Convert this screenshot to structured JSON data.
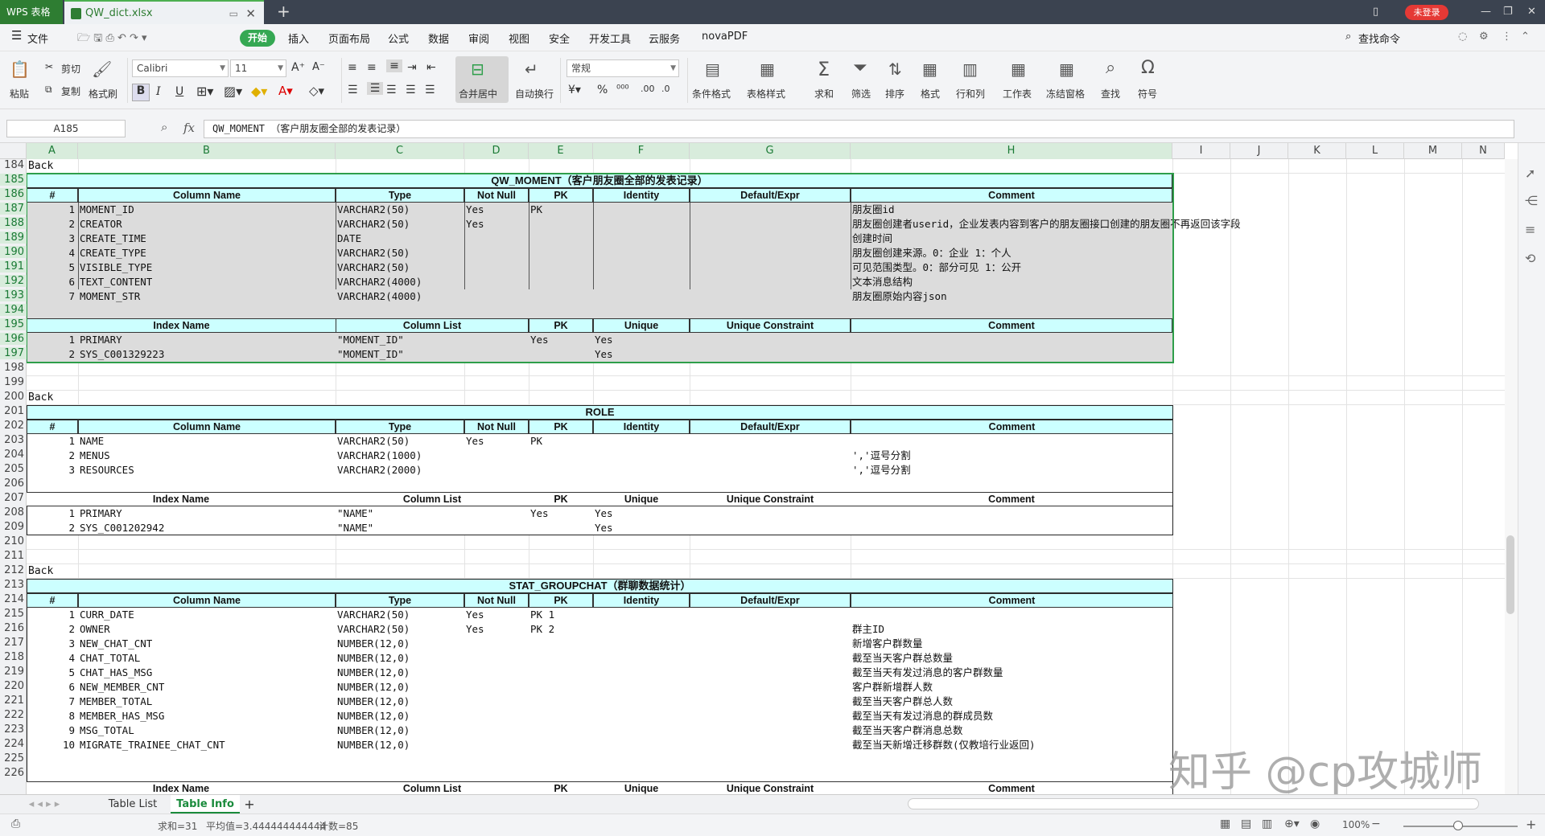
{
  "titlebar": {
    "app_tab": "WPS 表格",
    "file_tab": "QW_dict.xlsx",
    "login_badge": "未登录"
  },
  "menu": {
    "file": "文件",
    "start": "开始",
    "items": [
      "插入",
      "页面布局",
      "公式",
      "数据",
      "审阅",
      "视图",
      "安全",
      "开发工具",
      "云服务",
      "novaPDF"
    ],
    "search": "查找命令"
  },
  "toolbar": {
    "paste": "粘贴",
    "cut": "剪切",
    "copy": "复制",
    "format_painter": "格式刷",
    "font_name": "Calibri",
    "font_size": "11",
    "merge_center": "合并居中",
    "wrap": "自动换行",
    "number_format": "常规",
    "cond_format": "条件格式",
    "table_style": "表格样式",
    "sum": "求和",
    "filter": "筛选",
    "sort": "排序",
    "format": "格式",
    "rowcol": "行和列",
    "worksheet": "工作表",
    "freeze": "冻结窗格",
    "find": "查找",
    "symbol": "符号"
  },
  "formula_bar": {
    "name_box": "A185",
    "fx": "fx",
    "formula": "QW_MOMENT  （客户朋友圈全部的发表记录）"
  },
  "columns": [
    "A",
    "B",
    "C",
    "D",
    "E",
    "F",
    "G",
    "H",
    "I",
    "J",
    "K",
    "L",
    "M",
    "N"
  ],
  "rows": {
    "r184": "184",
    "r185": "185",
    "r186": "186",
    "r187": "187",
    "r188": "188",
    "r189": "189",
    "r190": "190",
    "r191": "191",
    "r192": "192",
    "r193": "193",
    "r194": "194",
    "r195": "195",
    "r196": "196",
    "r197": "197",
    "r198": "198",
    "r199": "199",
    "r200": "200",
    "r201": "201",
    "r202": "202",
    "r203": "203",
    "r204": "204",
    "r205": "205",
    "r206": "206",
    "r207": "207",
    "r208": "208",
    "r209": "209",
    "r210": "210",
    "r211": "211",
    "r212": "212",
    "r213": "213",
    "r214": "214",
    "r215": "215",
    "r216": "216",
    "r217": "217",
    "r218": "218",
    "r219": "219",
    "r220": "220",
    "r221": "221",
    "r222": "222",
    "r223": "223",
    "r224": "224",
    "r225": "225",
    "r226": "226"
  },
  "sheet": {
    "back": "Back",
    "col_headers": {
      "num": "#",
      "name": "Column Name",
      "type": "Type",
      "notnull": "Not Null",
      "pk": "PK",
      "identity": "Identity",
      "default": "Default/Expr",
      "comment": "Comment"
    },
    "idx_headers": {
      "name": "Index Name",
      "cols": "Column List",
      "pk": "PK",
      "unique": "Unique",
      "constraint": "Unique Constraint",
      "comment": "Comment"
    },
    "t1": {
      "title": "QW_MOMENT（客户朋友圈全部的发表记录）",
      "cols": [
        {
          "n": "1",
          "name": "MOMENT_ID",
          "type": "VARCHAR2(50)",
          "nn": "Yes",
          "pk": "PK",
          "comment": "朋友圈id"
        },
        {
          "n": "2",
          "name": "CREATOR",
          "type": "VARCHAR2(50)",
          "nn": "Yes",
          "pk": "",
          "comment": "朋友圈创建者userid，企业发表内容到客户的朋友圈接口创建的朋友圈不再返回该字段"
        },
        {
          "n": "3",
          "name": "CREATE_TIME",
          "type": "DATE",
          "nn": "",
          "pk": "",
          "comment": "创建时间"
        },
        {
          "n": "4",
          "name": "CREATE_TYPE",
          "type": "VARCHAR2(50)",
          "nn": "",
          "pk": "",
          "comment": "朋友圈创建来源。0：企业 1：个人"
        },
        {
          "n": "5",
          "name": "VISIBLE_TYPE",
          "type": "VARCHAR2(50)",
          "nn": "",
          "pk": "",
          "comment": "可见范围类型。0：部分可见 1：公开"
        },
        {
          "n": "6",
          "name": "TEXT_CONTENT",
          "type": "VARCHAR2(4000)",
          "nn": "",
          "pk": "",
          "comment": "文本消息结构"
        },
        {
          "n": "7",
          "name": "MOMENT_STR",
          "type": "VARCHAR2(4000)",
          "nn": "",
          "pk": "",
          "comment": "朋友圈原始内容json"
        }
      ],
      "idx": [
        {
          "n": "1",
          "name": "PRIMARY",
          "cols": "\"MOMENT_ID\"",
          "pk": "Yes",
          "unique": "Yes"
        },
        {
          "n": "2",
          "name": "SYS_C001329223",
          "cols": "\"MOMENT_ID\"",
          "pk": "",
          "unique": "Yes"
        }
      ]
    },
    "t2": {
      "title": "ROLE",
      "cols": [
        {
          "n": "1",
          "name": "NAME",
          "type": "VARCHAR2(50)",
          "nn": "Yes",
          "pk": "PK",
          "comment": ""
        },
        {
          "n": "2",
          "name": "MENUS",
          "type": "VARCHAR2(1000)",
          "nn": "",
          "pk": "",
          "comment": "','逗号分割"
        },
        {
          "n": "3",
          "name": "RESOURCES",
          "type": "VARCHAR2(2000)",
          "nn": "",
          "pk": "",
          "comment": "','逗号分割"
        }
      ],
      "idx": [
        {
          "n": "1",
          "name": "PRIMARY",
          "cols": "\"NAME\"",
          "pk": "Yes",
          "unique": "Yes"
        },
        {
          "n": "2",
          "name": "SYS_C001202942",
          "cols": "\"NAME\"",
          "pk": "",
          "unique": "Yes"
        }
      ]
    },
    "t3": {
      "title": "STAT_GROUPCHAT（群聊数据统计）",
      "cols": [
        {
          "n": "1",
          "name": "CURR_DATE",
          "type": "VARCHAR2(50)",
          "nn": "Yes",
          "pk": "PK 1",
          "comment": ""
        },
        {
          "n": "2",
          "name": "OWNER",
          "type": "VARCHAR2(50)",
          "nn": "Yes",
          "pk": "PK 2",
          "comment": "群主ID"
        },
        {
          "n": "3",
          "name": "NEW_CHAT_CNT",
          "type": "NUMBER(12,0)",
          "nn": "",
          "pk": "",
          "comment": "新增客户群数量"
        },
        {
          "n": "4",
          "name": "CHAT_TOTAL",
          "type": "NUMBER(12,0)",
          "nn": "",
          "pk": "",
          "comment": "截至当天客户群总数量"
        },
        {
          "n": "5",
          "name": "CHAT_HAS_MSG",
          "type": "NUMBER(12,0)",
          "nn": "",
          "pk": "",
          "comment": "截至当天有发过消息的客户群数量"
        },
        {
          "n": "6",
          "name": "NEW_MEMBER_CNT",
          "type": "NUMBER(12,0)",
          "nn": "",
          "pk": "",
          "comment": "客户群新增群人数"
        },
        {
          "n": "7",
          "name": "MEMBER_TOTAL",
          "type": "NUMBER(12,0)",
          "nn": "",
          "pk": "",
          "comment": "截至当天客户群总人数"
        },
        {
          "n": "8",
          "name": "MEMBER_HAS_MSG",
          "type": "NUMBER(12,0)",
          "nn": "",
          "pk": "",
          "comment": "截至当天有发过消息的群成员数"
        },
        {
          "n": "9",
          "name": "MSG_TOTAL",
          "type": "NUMBER(12,0)",
          "nn": "",
          "pk": "",
          "comment": "截至当天客户群消息总数"
        },
        {
          "n": "10",
          "name": "MIGRATE_TRAINEE_CHAT_CNT",
          "type": "NUMBER(12,0)",
          "nn": "",
          "pk": "",
          "comment": "截至当天新增迁移群数(仅教培行业返回)"
        }
      ]
    }
  },
  "sheet_tabs": [
    "Table List",
    "Table Info"
  ],
  "status": {
    "sum": "求和=31",
    "avg": "平均值=3.444444444444",
    "count": "计数=85",
    "zoom": "100%"
  },
  "watermark": "知乎 @cp攻城师"
}
